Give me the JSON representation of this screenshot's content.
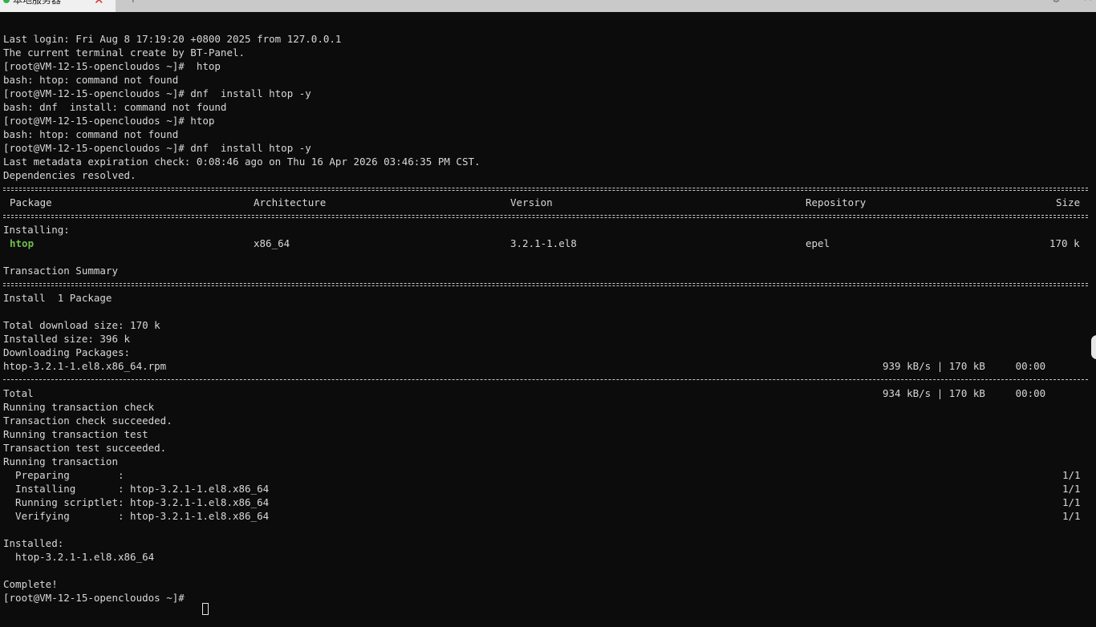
{
  "tab": {
    "title": "本地服务器",
    "close_glyph": "✕",
    "new_tab_glyph": "+",
    "settings_icon": "gear-icon",
    "link_icon": "link-icon"
  },
  "colors": {
    "terminal_bg": "#0c0c0c",
    "text": "#d8d8d8",
    "package_name": "#6cc04a",
    "tab_active_dot": "#2fb24a",
    "tab_close": "#e02b2b"
  },
  "terminal": {
    "session": [
      "Last login: Fri Aug 8 17:19:20 +0800 2025 from 127.0.0.1",
      "The current terminal create by BT-Panel.",
      "[root@VM-12-15-opencloudos ~]#  htop",
      "bash: htop: command not found",
      "[root@VM-12-15-opencloudos ~]# dnf  install htop -y",
      "bash: dnf  install: command not found",
      "[root@VM-12-15-opencloudos ~]# htop",
      "bash: htop: command not found",
      "[root@VM-12-15-opencloudos ~]# dnf  install htop -y",
      "Last metadata expiration check: 0:08:46 ago on Thu 16 Apr 2026 03:46:35 PM CST.",
      "Dependencies resolved."
    ],
    "table": {
      "headers": {
        "package": "Package",
        "arch": "Architecture",
        "version": "Version",
        "repo": "Repository",
        "size": "Size"
      },
      "section": "Installing:",
      "row": {
        "package": "htop",
        "arch": "x86_64",
        "version": "3.2.1-1.el8",
        "repo": "epel",
        "size": "170 k"
      }
    },
    "summary": {
      "title": "Transaction Summary",
      "install": "Install  1 Package",
      "download_size": "Total download size: 170 k",
      "installed_size": "Installed size: 396 k",
      "downloading": "Downloading Packages:"
    },
    "download": {
      "file": "htop-3.2.1-1.el8.x86_64.rpm",
      "file_stats": "939 kB/s | 170 kB     00:00",
      "total_label": "Total",
      "total_stats": "934 kB/s | 170 kB     00:00"
    },
    "transaction": [
      "Running transaction check",
      "Transaction check succeeded.",
      "Running transaction test",
      "Transaction test succeeded.",
      "Running transaction"
    ],
    "steps": [
      {
        "label": "  Preparing        :",
        "progress": "1/1"
      },
      {
        "label": "  Installing       : htop-3.2.1-1.el8.x86_64",
        "progress": "1/1"
      },
      {
        "label": "  Running scriptlet: htop-3.2.1-1.el8.x86_64",
        "progress": "1/1"
      },
      {
        "label": "  Verifying        : htop-3.2.1-1.el8.x86_64",
        "progress": "1/1"
      }
    ],
    "installed_title": "Installed:",
    "installed_pkg": "  htop-3.2.1-1.el8.x86_64",
    "complete": "Complete!",
    "prompt": "[root@VM-12-15-opencloudos ~]# "
  }
}
